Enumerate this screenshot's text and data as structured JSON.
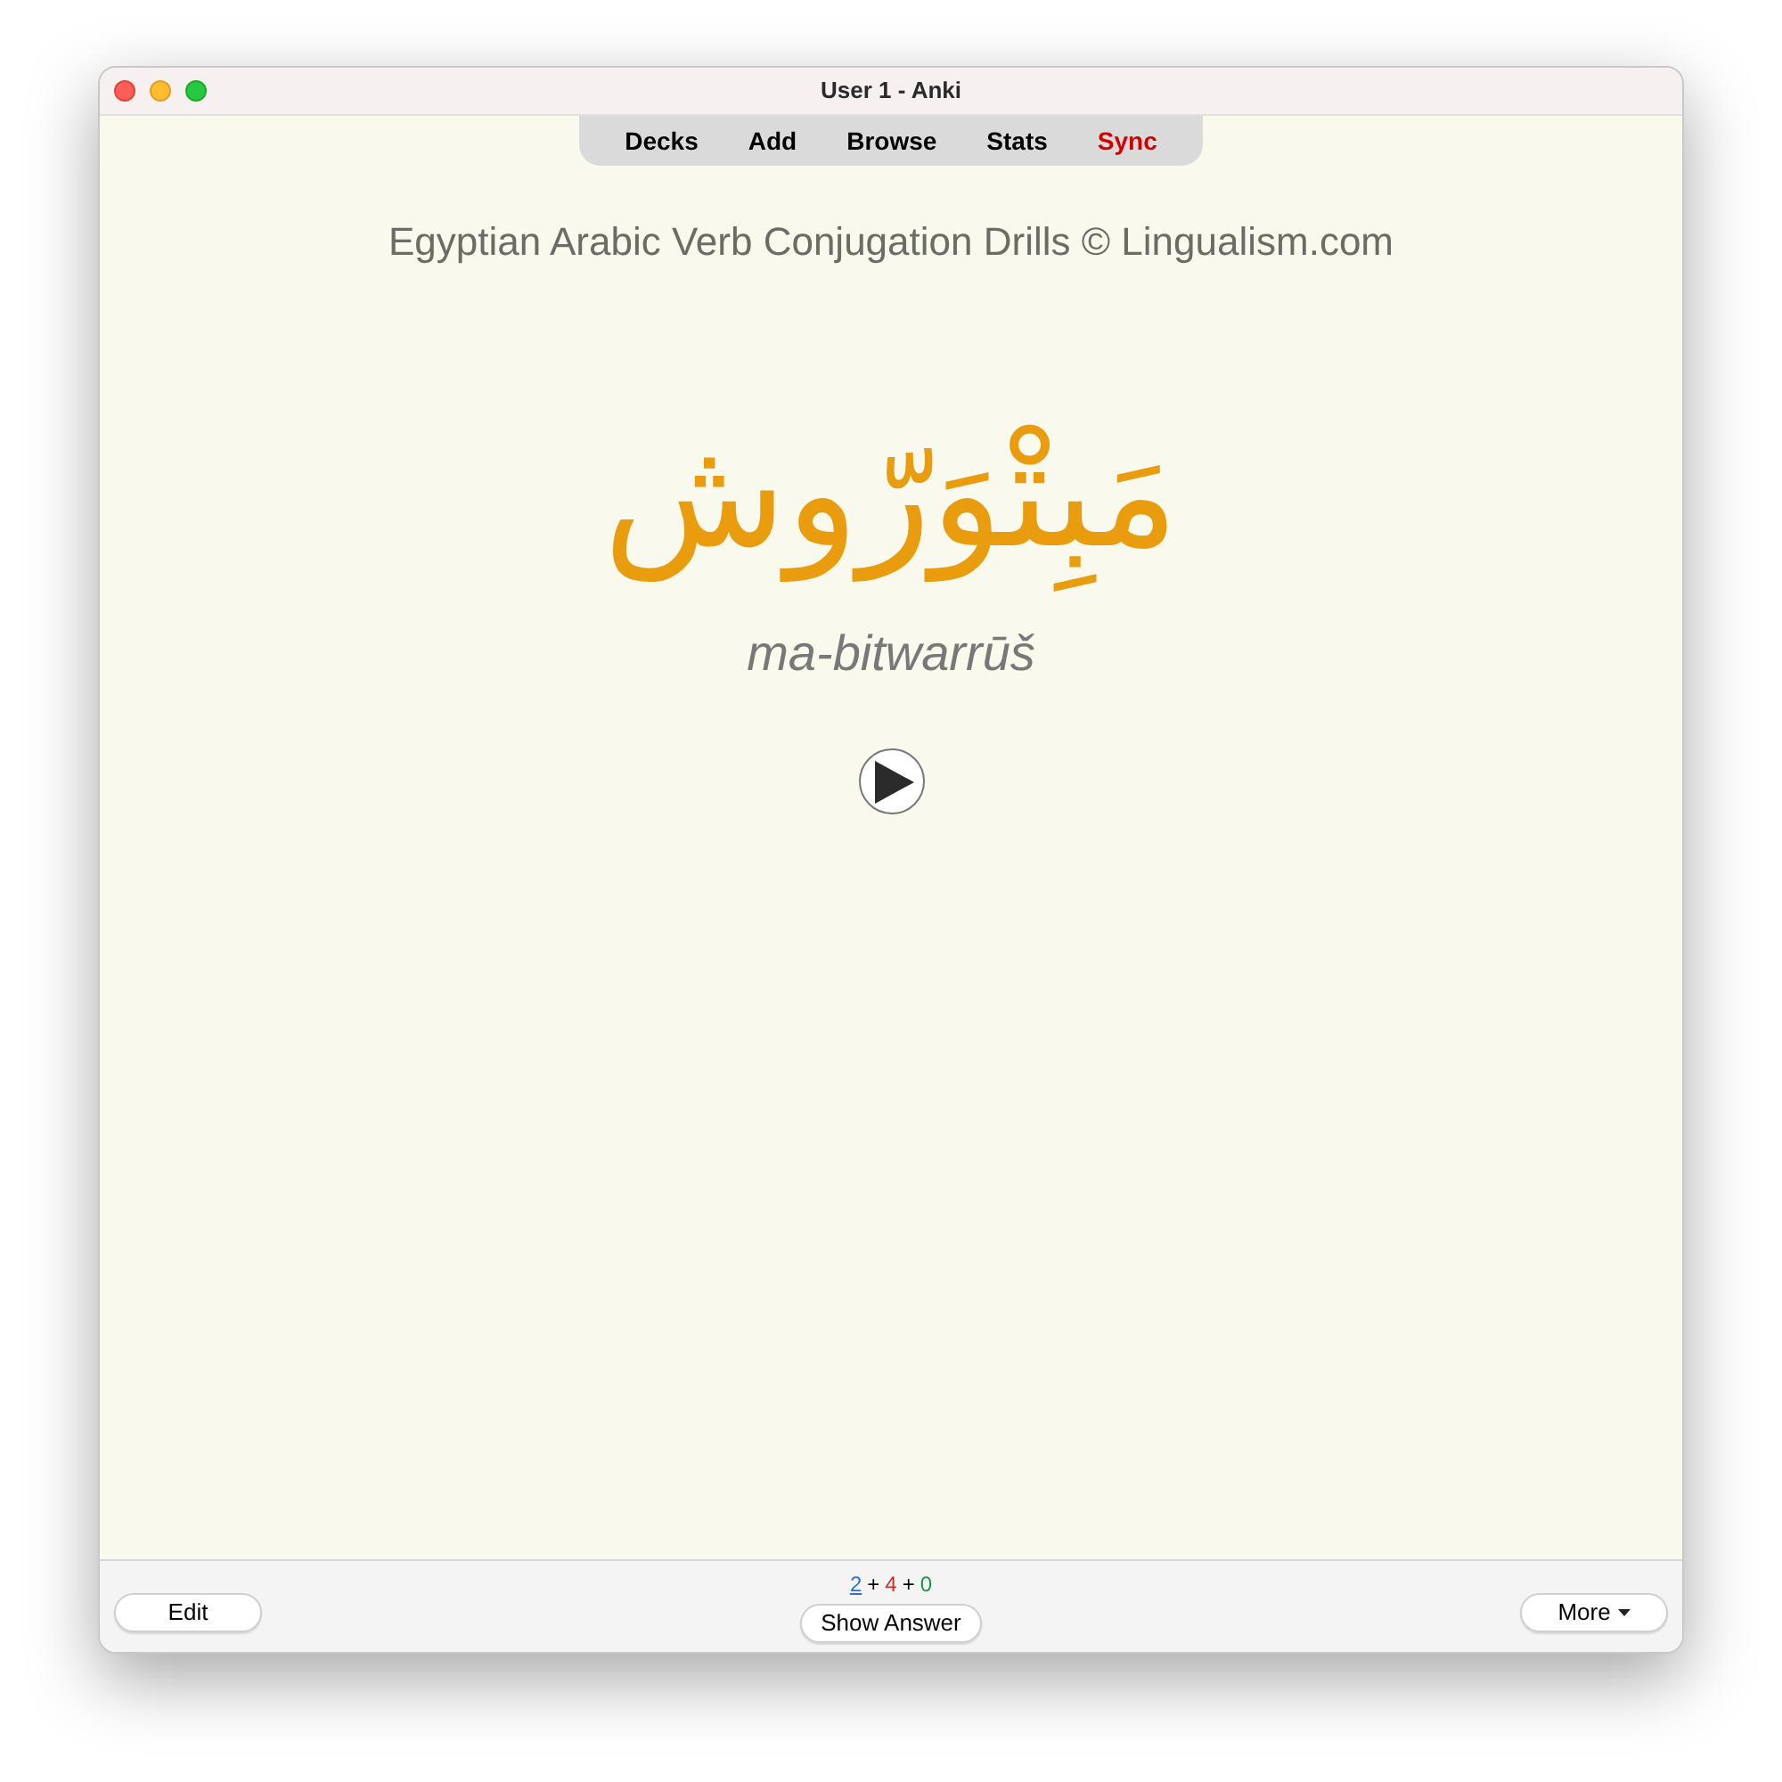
{
  "window": {
    "title": "User 1 - Anki"
  },
  "toolbar": [
    {
      "label": "Decks",
      "color": "#000000"
    },
    {
      "label": "Add",
      "color": "#000000"
    },
    {
      "label": "Browse",
      "color": "#000000"
    },
    {
      "label": "Stats",
      "color": "#000000"
    },
    {
      "label": "Sync",
      "color": "#d40000"
    }
  ],
  "card": {
    "deck_title": "Egyptian Arabic Verb Conjugation Drills © Lingualism.com",
    "word": "مَبِتْوَرّوش",
    "transliteration": "ma-bitwarrūš"
  },
  "footer": {
    "edit_button": "Edit",
    "counts": [
      {
        "kind": "count",
        "text": "2",
        "color": "#2f6fd0",
        "current": true
      },
      {
        "kind": "separator",
        "text": "+"
      },
      {
        "kind": "count",
        "text": "4",
        "color": "#d42a2a",
        "current": false
      },
      {
        "kind": "separator",
        "text": "+"
      },
      {
        "kind": "count",
        "text": "0",
        "color": "#16964a",
        "current": false
      }
    ],
    "show_answer_button": "Show Answer",
    "more_button": "More"
  }
}
